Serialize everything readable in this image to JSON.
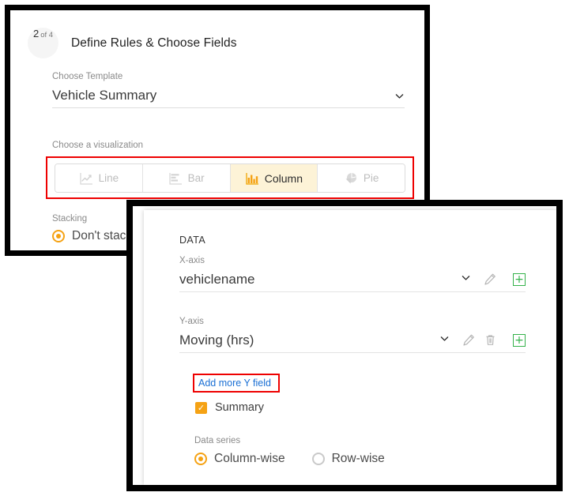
{
  "wizard": {
    "step_number": "2",
    "step_of": "of 4",
    "title": "Define Rules & Choose Fields",
    "template": {
      "label": "Choose Template",
      "value": "Vehicle Summary",
      "chevron_icon": "chevron-down-icon"
    },
    "visualization": {
      "label": "Choose a visualization",
      "options": [
        {
          "label": "Line",
          "icon": "line-chart-icon",
          "selected": false
        },
        {
          "label": "Bar",
          "icon": "bar-chart-icon",
          "selected": false
        },
        {
          "label": "Column",
          "icon": "column-chart-icon",
          "selected": true
        },
        {
          "label": "Pie",
          "icon": "pie-chart-icon",
          "selected": false
        }
      ],
      "selected_value": "Column",
      "highlight_color": "#ee0000",
      "selected_bg": "#fdf3d7"
    },
    "stacking": {
      "label": "Stacking",
      "options": [
        {
          "label": "Don't stack",
          "selected": true
        }
      ],
      "selected_value": "Don't stack"
    }
  },
  "data_panel": {
    "heading": "DATA",
    "x_axis": {
      "label": "X-axis",
      "value": "vehiclename",
      "icons": [
        "chevron-down-icon",
        "pencil-edit-icon",
        "plus-add-icon"
      ]
    },
    "y_axis": {
      "label": "Y-axis",
      "value": "Moving (hrs)",
      "icons": [
        "chevron-down-icon",
        "pencil-edit-icon",
        "trash-delete-icon",
        "plus-add-icon"
      ]
    },
    "add_more_y": {
      "label": "Add more Y field",
      "link_color": "#1a6fd4",
      "highlight_color": "#ee0000"
    },
    "summary": {
      "label": "Summary",
      "checked": true,
      "check_glyph": "✓",
      "accent_color": "#f5a214"
    },
    "data_series": {
      "label": "Data series",
      "options": [
        {
          "label": "Column-wise",
          "selected": true
        },
        {
          "label": "Row-wise",
          "selected": false
        }
      ],
      "selected_value": "Column-wise"
    },
    "plus_glyph": "+"
  }
}
